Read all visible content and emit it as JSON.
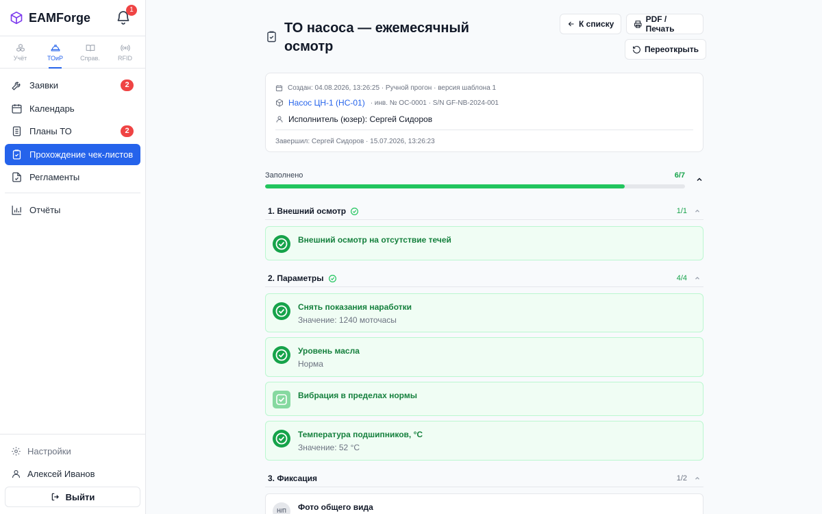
{
  "app": {
    "name": "EAMForge",
    "notification_count": "1"
  },
  "modules": [
    {
      "label": "Учёт",
      "icon": "cubes-icon"
    },
    {
      "label": "ТОиР",
      "icon": "helmet-icon"
    },
    {
      "label": "Справ.",
      "icon": "book-icon"
    },
    {
      "label": "RFID",
      "icon": "rfid-icon"
    }
  ],
  "nav": {
    "requests": {
      "label": "Заявки",
      "badge": "2"
    },
    "calendar": {
      "label": "Календарь"
    },
    "plans": {
      "label": "Планы ТО",
      "badge": "2"
    },
    "checklists": {
      "label": "Прохождение чек-листов"
    },
    "regulations": {
      "label": "Регламенты"
    },
    "reports": {
      "label": "Отчёты"
    }
  },
  "footer": {
    "settings": "Настройки",
    "user": "Алексей Иванов",
    "logout": "Выйти"
  },
  "page": {
    "title": "ТО насоса — ежемесячный осмотр",
    "back_button": "К списку",
    "print_button": "PDF / Печать",
    "reopen_button": "Переоткрыть"
  },
  "info": {
    "created": "Создан: 04.08.2026, 13:26:25 · Ручной прогон · версия шаблона 1",
    "asset_name": "Насос ЦН-1 (НС-01)",
    "asset_meta": "· инв. № ОС-0001 · S/N GF-NB-2024-001",
    "executor": "Исполнитель (юзер): Сергей Сидоров",
    "completed": "Завершил: Сергей Сидоров · 15.07.2026, 13:26:23"
  },
  "progress": {
    "label": "Заполнено",
    "value": "6/7",
    "fraction": 0.857
  },
  "sections": [
    {
      "title": "1. Внешний осмотр",
      "count": "1/1",
      "items": [
        {
          "title": "Внешний осмотр на отсутствие течей"
        }
      ]
    },
    {
      "title": "2. Параметры",
      "count": "4/4",
      "items": [
        {
          "title": "Снять показания наработки",
          "sub": "Значение: 1240 моточасы"
        },
        {
          "title": "Уровень масла",
          "sub": "Норма"
        },
        {
          "title": "Вибрация в пределах нормы"
        },
        {
          "title": "Температура подшипников, °C",
          "sub": "Значение: 52 °C"
        }
      ]
    },
    {
      "title": "3. Фиксация",
      "count": "1/2",
      "items": [
        {
          "title": "Фото общего вида",
          "badge": "Н/П"
        }
      ]
    }
  ],
  "colors": {
    "accent": "#2563eb",
    "success": "#22c55e",
    "danger": "#ef4444"
  }
}
